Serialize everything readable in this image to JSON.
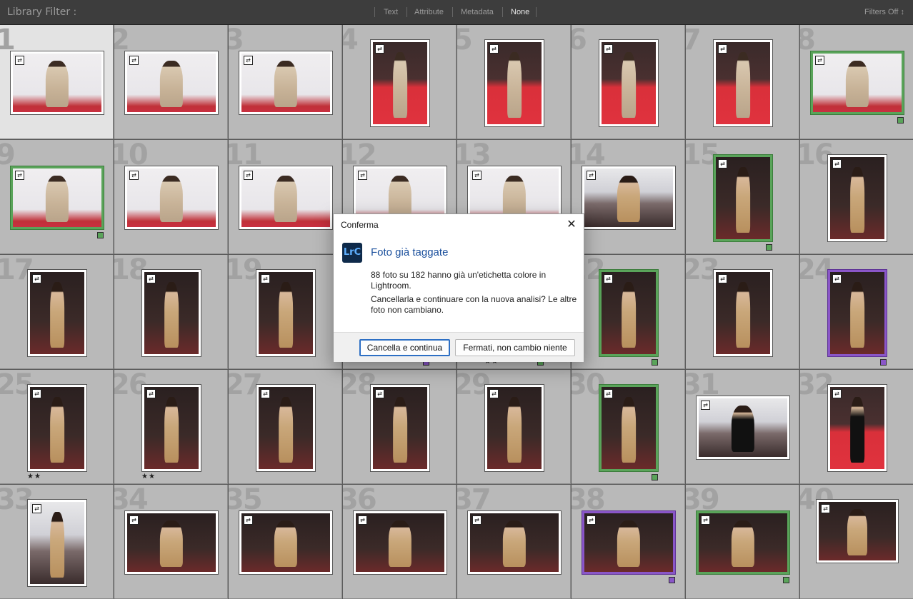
{
  "filter_bar": {
    "title": "Library Filter :",
    "options": [
      "Text",
      "Attribute",
      "Metadata",
      "None"
    ],
    "active": "None",
    "filters_status": "Filters Off ↕"
  },
  "grid": {
    "cells": [
      {
        "num": "1",
        "label": "",
        "stars": ""
      },
      {
        "num": "2",
        "label": "",
        "stars": ""
      },
      {
        "num": "3",
        "label": "",
        "stars": ""
      },
      {
        "num": "4",
        "label": "",
        "stars": ""
      },
      {
        "num": "5",
        "label": "",
        "stars": ""
      },
      {
        "num": "6",
        "label": "",
        "stars": ""
      },
      {
        "num": "7",
        "label": "",
        "stars": ""
      },
      {
        "num": "8",
        "label": "green",
        "stars": ""
      },
      {
        "num": "9",
        "label": "green",
        "stars": ""
      },
      {
        "num": "10",
        "label": "",
        "stars": ""
      },
      {
        "num": "11",
        "label": "",
        "stars": ""
      },
      {
        "num": "12",
        "label": "",
        "stars": ""
      },
      {
        "num": "13",
        "label": "",
        "stars": ""
      },
      {
        "num": "14",
        "label": "",
        "stars": ""
      },
      {
        "num": "15",
        "label": "green",
        "stars": ""
      },
      {
        "num": "16",
        "label": "",
        "stars": ""
      },
      {
        "num": "17",
        "label": "",
        "stars": ""
      },
      {
        "num": "18",
        "label": "",
        "stars": ""
      },
      {
        "num": "19",
        "label": "",
        "stars": ""
      },
      {
        "num": "20",
        "label": "purple",
        "stars": ""
      },
      {
        "num": "21",
        "label": "green",
        "stars": "★★"
      },
      {
        "num": "22",
        "label": "green",
        "stars": ""
      },
      {
        "num": "23",
        "label": "",
        "stars": ""
      },
      {
        "num": "24",
        "label": "purple",
        "stars": ""
      },
      {
        "num": "25",
        "label": "",
        "stars": "★★"
      },
      {
        "num": "26",
        "label": "",
        "stars": "★★"
      },
      {
        "num": "27",
        "label": "",
        "stars": ""
      },
      {
        "num": "28",
        "label": "",
        "stars": ""
      },
      {
        "num": "29",
        "label": "",
        "stars": ""
      },
      {
        "num": "30",
        "label": "green",
        "stars": ""
      },
      {
        "num": "31",
        "label": "",
        "stars": ""
      },
      {
        "num": "32",
        "label": "",
        "stars": ""
      },
      {
        "num": "33",
        "label": "",
        "stars": ""
      },
      {
        "num": "34",
        "label": "",
        "stars": ""
      },
      {
        "num": "35",
        "label": "",
        "stars": ""
      },
      {
        "num": "36",
        "label": "",
        "stars": ""
      },
      {
        "num": "37",
        "label": "",
        "stars": ""
      },
      {
        "num": "38",
        "label": "purple",
        "stars": ""
      },
      {
        "num": "39",
        "label": "green",
        "stars": ""
      },
      {
        "num": "40",
        "label": "",
        "stars": ""
      }
    ]
  },
  "dialog": {
    "window_title": "Conferma",
    "close_glyph": "✕",
    "icon_text": "LrC",
    "heading": "Foto già taggate",
    "message_1": "88 foto su 182 hanno già un'etichetta colore in Lightroom.",
    "message_2": "Cancellarla e continuare con la nuova analisi? Le altre foto non cambiano.",
    "primary_button": "Cancella e continua",
    "secondary_button": "Fermati, non cambio niente"
  },
  "icons": {
    "stack_badge_glyph": "⇄"
  },
  "colors": {
    "green_label": "#5aa45a",
    "purple_label": "#8a56c8",
    "dialog_heading": "#1a4f9c",
    "primary_border": "#2d6fc4"
  }
}
